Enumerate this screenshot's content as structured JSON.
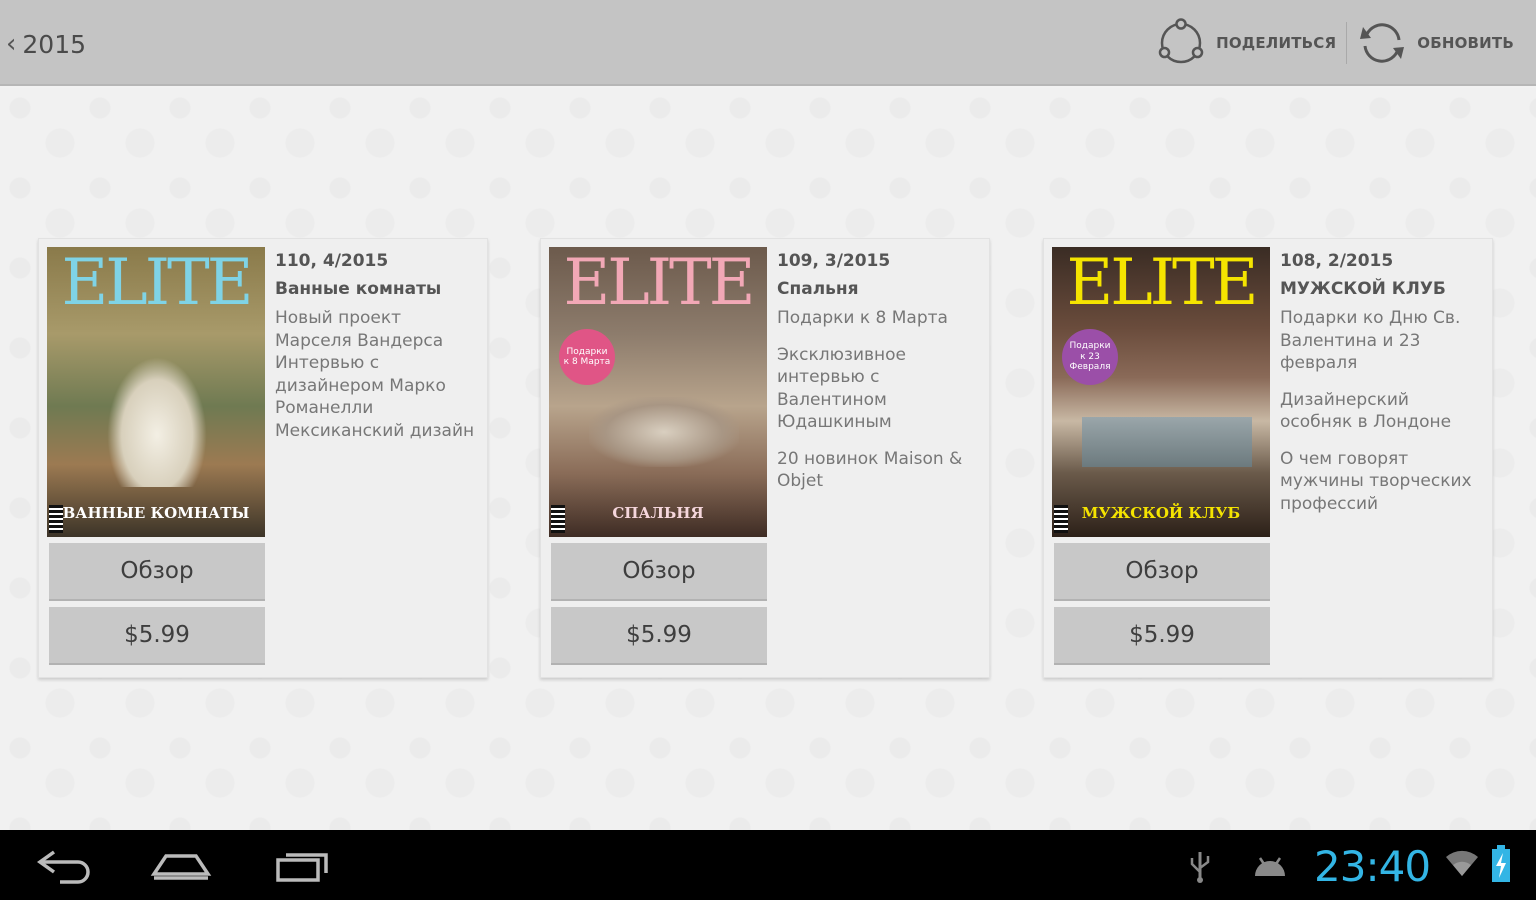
{
  "actionbar": {
    "back_label": "2015",
    "share_label": "поделиться",
    "refresh_label": "обновить"
  },
  "issues": [
    {
      "issue": "110, 4/2015",
      "title": "Ванные комнаты",
      "descriptions": [
        "Новый проект Марселя Вандерса Интервью с дизайнером Марко Романелли Мексиканский дизайн"
      ],
      "review_label": "Обзор",
      "price_label": "$5.99",
      "cover_brand": "ELITE",
      "cover_brand_color": "#7fd3e6",
      "cover_headline": "ВАННЫЕ КОМНАТЫ"
    },
    {
      "issue": "109, 3/2015",
      "title": "Спальня",
      "descriptions": [
        "Подарки к 8 Марта",
        "Эксклюзивное интервью с Валентином Юдашкиным",
        "20 новинок Maison & Objet"
      ],
      "review_label": "Обзор",
      "price_label": "$5.99",
      "cover_brand": "ELITE",
      "cover_brand_color": "#f2a8b6",
      "cover_headline": "СПАЛЬНЯ",
      "cover_sticker": "Подарки к 8 Марта",
      "cover_sticker_color": "#e05586"
    },
    {
      "issue": "108, 2/2015",
      "title": "МУЖСКОЙ КЛУБ",
      "descriptions": [
        "Подарки ко Дню Св. Валентина и 23 февраля",
        "Дизайнерский особняк в Лондоне",
        "О чем говорят мужчины творческих профессий"
      ],
      "review_label": "Обзор",
      "price_label": "$5.99",
      "cover_brand": "ELITE",
      "cover_brand_color": "#f5e400",
      "cover_headline": "МУЖСКОЙ КЛУБ",
      "cover_sticker": "Подарки к 23 Февраля",
      "cover_sticker_color": "#9b4fa8"
    }
  ],
  "statusbar": {
    "time": "23:40"
  },
  "colors": {
    "accent_clock": "#33b5e5",
    "actionbar_bg": "#c4c4c4"
  }
}
